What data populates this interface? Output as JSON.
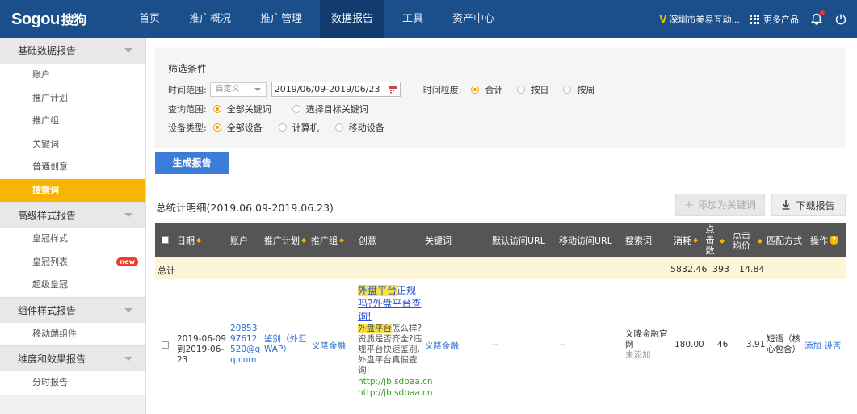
{
  "header": {
    "logo": "Sogou",
    "logo_cn": "搜狗",
    "nav": [
      "首页",
      "推广概况",
      "推广管理",
      "数据报告",
      "工具",
      "资产中心"
    ],
    "company": "深圳市美易互动...",
    "more_products": "更多产品"
  },
  "sidebar": {
    "groups": [
      {
        "label": "基础数据报告",
        "items": [
          "账户",
          "推广计划",
          "推广组",
          "关键词",
          "普通创意",
          "搜索词"
        ]
      },
      {
        "label": "高级样式报告",
        "items": [
          "皇冠样式",
          "皇冠列表",
          "超级皇冠"
        ]
      },
      {
        "label": "组件样式报告",
        "items": [
          "移动端组件"
        ]
      },
      {
        "label": "维度和效果报告",
        "items": [
          "分时报告"
        ]
      }
    ],
    "badge_new": "new"
  },
  "filter": {
    "title": "筛选条件",
    "time_range_label": "时间范围:",
    "time_range_select": "自定义",
    "date_value": "2019/06/09-2019/06/23",
    "granularity_label": "时间粒度:",
    "granularity_options": [
      "合计",
      "按日",
      "按周"
    ],
    "query_scope_label": "查询范围:",
    "query_scope_options": [
      "全部关键词",
      "选择目标关键词"
    ],
    "device_label": "设备类型:",
    "device_options": [
      "全部设备",
      "计算机",
      "移动设备"
    ]
  },
  "buttons": {
    "generate": "生成报告",
    "add_keyword": "添加为关键词",
    "download": "下载报告"
  },
  "summary_title": "总统计明细(2019.06.09-2019.06.23)",
  "table": {
    "headers": {
      "date": "日期",
      "account": "账户",
      "plan": "推广计划",
      "group": "推广组",
      "creative": "创意",
      "keyword": "关键词",
      "default_url": "默认访问URL",
      "mobile_url": "移动访问URL",
      "search_term": "搜索词",
      "cost": "消耗",
      "clicks": "点击数",
      "avg_cpc": "点击均价",
      "match": "匹配方式",
      "ops": "操作"
    },
    "total": {
      "label": "总计",
      "cost": "5832.46",
      "clicks": "393",
      "avg_cpc": "14.84"
    },
    "rows": [
      {
        "date": "2019-06-09到2019-06-23",
        "account": "2085397612520@qq.com",
        "plan": "鉴别（外汇WAP）",
        "group": "义隆金融",
        "creative_title_hl1": "外盘平台",
        "creative_title_1": "正规吗?",
        "creative_title_2": "外盘平台查询!",
        "creative_desc_hl": "外盘平台",
        "creative_desc": "怎么样?资质是否齐全?违规平台快速鉴别,外盘平台真假查询!",
        "creative_url1": "http://jb.sdbaa.cn",
        "creative_url2": "http://jb.sdbaa.cn",
        "keyword": "义隆金融",
        "default_url": "--",
        "mobile_url": "--",
        "search_term": "义隆金融官网",
        "search_term_status": "未添加",
        "cost": "180.00",
        "clicks": "46",
        "avg_cpc": "3.91",
        "match": "短语（核心包含）",
        "op_add": "添加",
        "op_set": "设否"
      }
    ]
  }
}
